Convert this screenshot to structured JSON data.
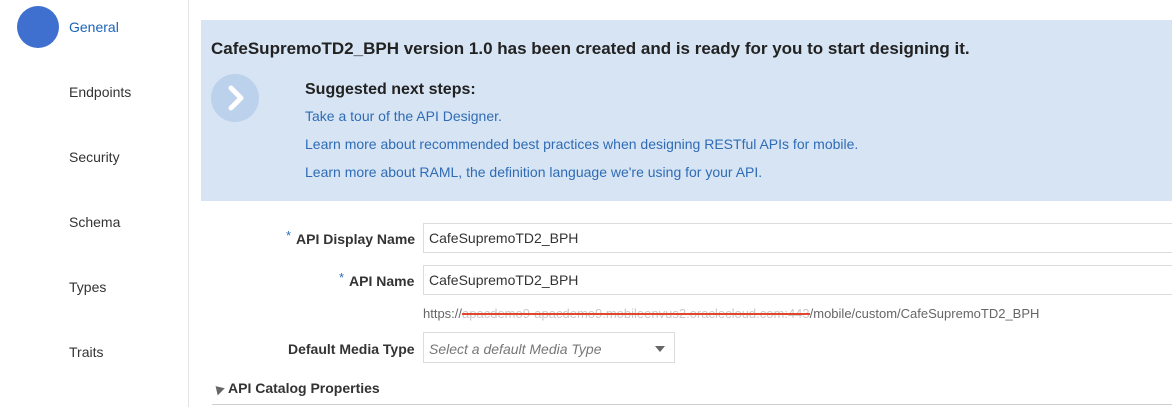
{
  "sidebar": {
    "items": [
      {
        "label": "General"
      },
      {
        "label": "Endpoints"
      },
      {
        "label": "Security"
      },
      {
        "label": "Schema"
      },
      {
        "label": "Types"
      },
      {
        "label": "Traits"
      }
    ]
  },
  "banner": {
    "title": "CafeSupremoTD2_BPH version 1.0 has been created and is ready for you to start designing it.",
    "steps_heading": "Suggested next steps:",
    "links": [
      "Take a tour of the API Designer.",
      "Learn more about recommended best practices when designing RESTful APIs for mobile.",
      "Learn more about RAML, the definition language we're using for your API."
    ]
  },
  "form": {
    "display_name_label": "API Display Name",
    "display_name_value": "CafeSupremoTD2_BPH",
    "api_name_label": "API Name",
    "api_name_value": "CafeSupremoTD2_BPH",
    "required_marker": "*",
    "url_prefix": "https://",
    "url_redacted": "apacdemo9-apacdemo9.mobileenvus2.oraclecloud.com:443",
    "url_suffix": "/mobile/custom/CafeSupremoTD2_BPH",
    "media_type_label": "Default Media Type",
    "media_type_placeholder": "Select a default Media Type"
  },
  "section": {
    "catalog_label": "API Catalog Properties"
  },
  "colors": {
    "accent": "#3f6fcf",
    "banner_bg": "#d6e4f4",
    "link": "#2f6cb5",
    "redaction": "#e2452b"
  }
}
